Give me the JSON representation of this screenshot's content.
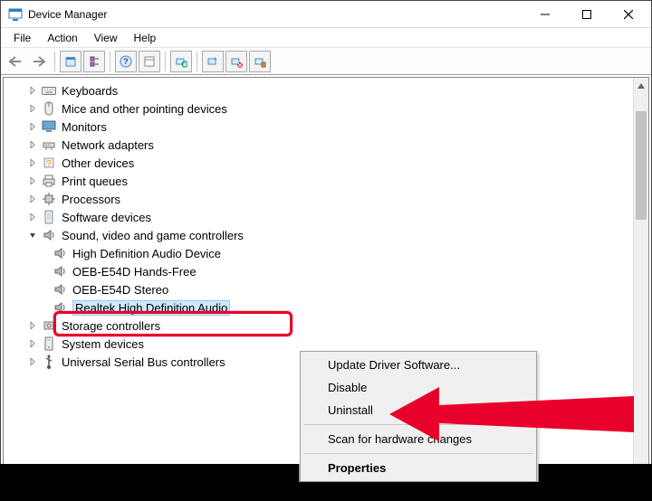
{
  "window": {
    "title": "Device Manager"
  },
  "menu": {
    "items": [
      "File",
      "Action",
      "View",
      "Help"
    ]
  },
  "tree": {
    "items": [
      {
        "label": "Keyboards",
        "icon": "keyboard",
        "expandable": true
      },
      {
        "label": "Mice and other pointing devices",
        "icon": "mouse",
        "expandable": true
      },
      {
        "label": "Monitors",
        "icon": "monitor",
        "expandable": true
      },
      {
        "label": "Network adapters",
        "icon": "network",
        "expandable": true
      },
      {
        "label": "Other devices",
        "icon": "other",
        "expandable": true
      },
      {
        "label": "Print queues",
        "icon": "printer",
        "expandable": true
      },
      {
        "label": "Processors",
        "icon": "cpu",
        "expandable": true
      },
      {
        "label": "Software devices",
        "icon": "software",
        "expandable": true
      },
      {
        "label": "Sound, video and game controllers",
        "icon": "sound",
        "expandable": true,
        "expanded": true,
        "children": [
          {
            "label": "High Definition Audio Device",
            "icon": "speaker"
          },
          {
            "label": "OEB-E54D Hands-Free",
            "icon": "speaker"
          },
          {
            "label": "OEB-E54D Stereo",
            "icon": "speaker"
          },
          {
            "label": "Realtek High Definition Audio",
            "icon": "speaker",
            "selected": true,
            "highlighted": true
          }
        ]
      },
      {
        "label": "Storage controllers",
        "icon": "storage",
        "expandable": true
      },
      {
        "label": "System devices",
        "icon": "system",
        "expandable": true
      },
      {
        "label": "Universal Serial Bus controllers",
        "icon": "usb",
        "expandable": true
      }
    ]
  },
  "context_menu": {
    "items": [
      {
        "label": "Update Driver Software...",
        "type": "item"
      },
      {
        "label": "Disable",
        "type": "item"
      },
      {
        "label": "Uninstall",
        "type": "item"
      },
      {
        "type": "sep"
      },
      {
        "label": "Scan for hardware changes",
        "type": "item"
      },
      {
        "type": "sep"
      },
      {
        "label": "Properties",
        "type": "item",
        "bold": true
      }
    ]
  }
}
